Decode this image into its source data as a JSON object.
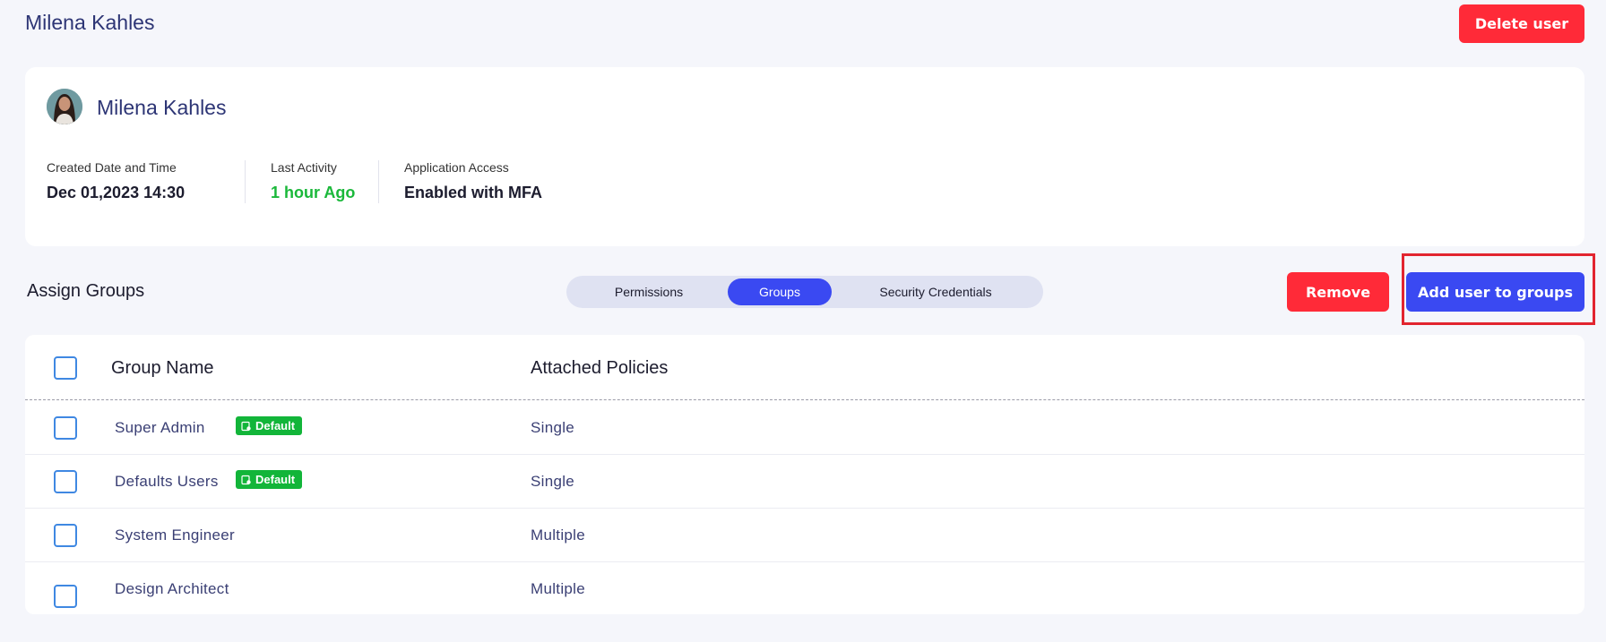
{
  "header": {
    "title": "Milena Kahles",
    "delete_label": "Delete user"
  },
  "profile": {
    "name": "Milena Kahles",
    "created_label": "Created Date and Time",
    "created_value": "Dec 01,2023 14:30",
    "activity_label": "Last Activity",
    "activity_value": "1 hour Ago",
    "access_label": "Application Access",
    "access_value": "Enabled with MFA"
  },
  "section": {
    "title": "Assign Groups"
  },
  "tabs": [
    {
      "label": "Permissions",
      "active": false
    },
    {
      "label": "Groups",
      "active": true
    },
    {
      "label": "Security Credentials",
      "active": false
    }
  ],
  "actions": {
    "remove_label": "Remove",
    "add_label": "Add user to groups"
  },
  "table": {
    "columns": [
      "Group Name",
      "Attached Policies"
    ],
    "rows": [
      {
        "name": "Super Admin",
        "badge": "Default",
        "policy": "Single"
      },
      {
        "name": "Defaults Users",
        "badge": "Default",
        "policy": "Single"
      },
      {
        "name": "System Engineer",
        "badge": "",
        "policy": "Multiple"
      },
      {
        "name": "Design Architect",
        "badge": "",
        "policy": "Multiple"
      }
    ]
  },
  "colors": {
    "accent": "#3a49f2",
    "danger": "#ff2a38",
    "success": "#12b539",
    "highlight": "#e2252f"
  }
}
